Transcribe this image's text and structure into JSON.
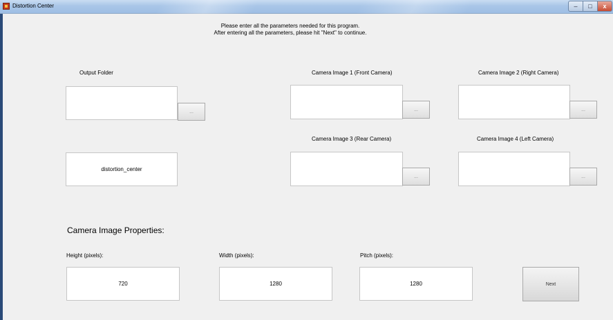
{
  "window": {
    "title": "Distortion Center",
    "min_glyph": "–",
    "max_glyph": "□",
    "close_glyph": "x"
  },
  "instructions": {
    "line1": "Please enter all the parameters needed for this program.",
    "line2": "After entering all the parameters, please hit \"Next\" to continue."
  },
  "output_folder": {
    "label": "Output Folder",
    "value": "",
    "browse_label": "..."
  },
  "camera_images": [
    {
      "label": "Camera Image 1 (Front Camera)",
      "value": "",
      "browse_label": "..."
    },
    {
      "label": "Camera Image 2 (Right Camera)",
      "value": "",
      "browse_label": "..."
    },
    {
      "label": "Camera Image 3 (Rear Camera)",
      "value": "",
      "browse_label": "..."
    },
    {
      "label": "Camera Image 4 (Left Camera)",
      "value": "",
      "browse_label": "..."
    }
  ],
  "folder_name": {
    "value": "distortion_center"
  },
  "properties": {
    "heading": "Camera Image Properties:",
    "height": {
      "label": "Height (pixels):",
      "value": "720"
    },
    "width": {
      "label": "Width (pixels):",
      "value": "1280"
    },
    "pitch": {
      "label": "Pitch (pixels):",
      "value": "1280"
    }
  },
  "next_button": {
    "label": "Next"
  }
}
